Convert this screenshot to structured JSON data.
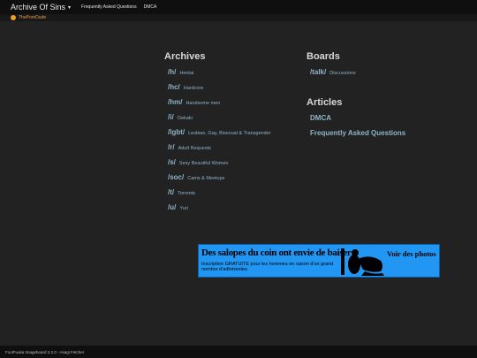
{
  "header": {
    "brand": "Archive Of Sins",
    "brand_caret": "▾",
    "nav": [
      "Frequently Asked Questions",
      "DMCA"
    ]
  },
  "subheader": {
    "site_link": "ThePornDude"
  },
  "archives": {
    "title": "Archives",
    "boards": [
      {
        "code": "/h/",
        "name": "Hentai"
      },
      {
        "code": "/hc/",
        "name": "Hardcore"
      },
      {
        "code": "/hm/",
        "name": "Handsome men"
      },
      {
        "code": "/i/",
        "name": "Oekaki"
      },
      {
        "code": "/lgbt/",
        "name": "Lesbian, Gay, Bisexual & Transgender"
      },
      {
        "code": "/r/",
        "name": "Adult Requests"
      },
      {
        "code": "/s/",
        "name": "Sexy Beautiful Women"
      },
      {
        "code": "/soc/",
        "name": "Cams & Meetups"
      },
      {
        "code": "/t/",
        "name": "Torrents"
      },
      {
        "code": "/u/",
        "name": "Yuri"
      }
    ]
  },
  "boards": {
    "title": "Boards",
    "items": [
      {
        "code": "/talk/",
        "name": "Discussions"
      }
    ]
  },
  "articles": {
    "title": "Articles",
    "items": [
      "DMCA",
      "Frequently Asked Questions"
    ]
  },
  "banner": {
    "headline": "Des salopes du coin ont envie de baiser !",
    "subtext": "Inscription GRATUITE pour les hommes en raison d'un grand nombre d'adhérentes.",
    "cta": "Voir des photos"
  },
  "footer": {
    "text": "FoolFuuka Imageboard 2.2.0 - Asagi Fetcher"
  }
}
